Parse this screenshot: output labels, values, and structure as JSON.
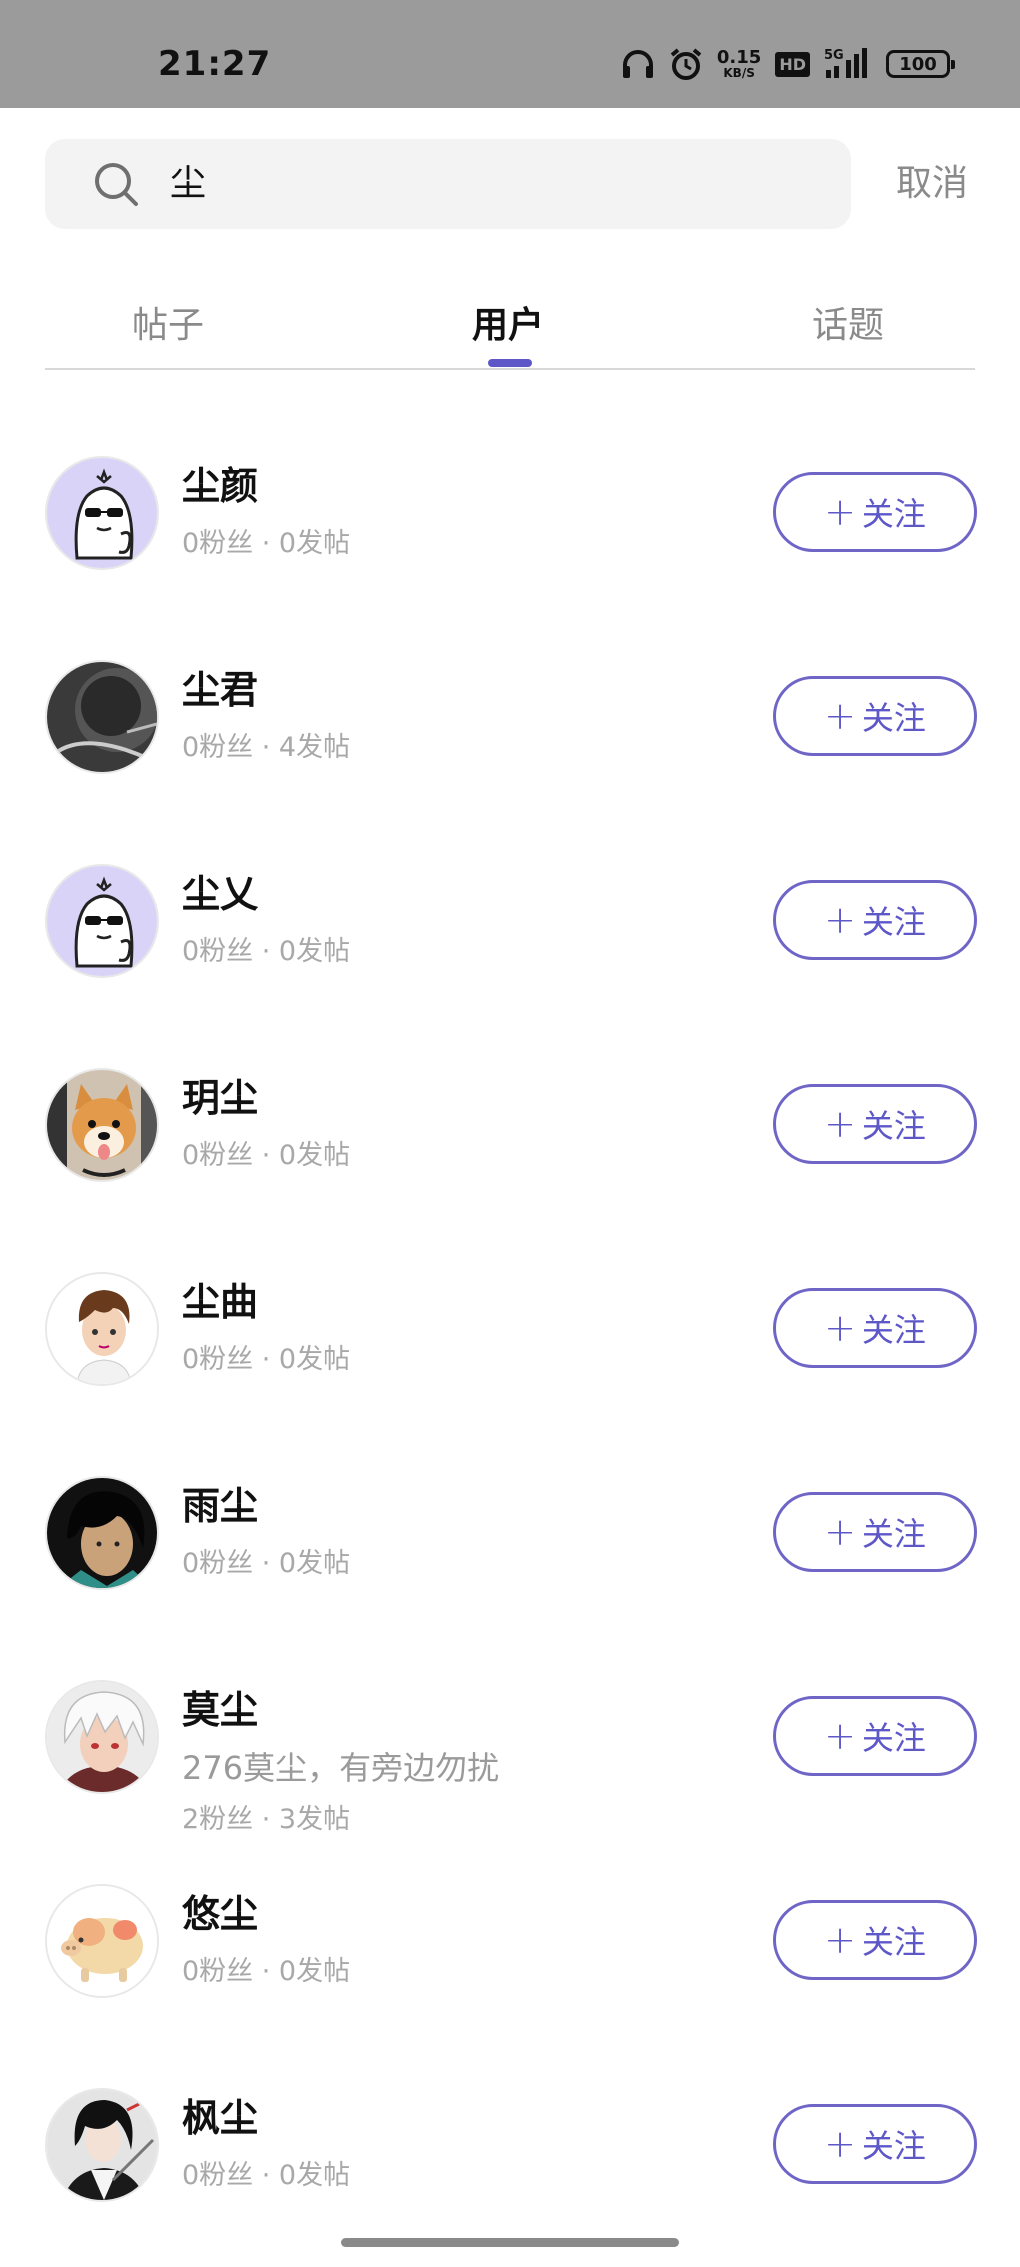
{
  "status_bar": {
    "time": "21:27",
    "net_speed_value": "0.15",
    "net_speed_unit": "KB/S",
    "hd": "HD",
    "network": "5G",
    "battery": "100",
    "icons": [
      "headphones-icon",
      "alarm-icon",
      "signal-icon"
    ]
  },
  "search": {
    "query": "尘",
    "cancel_label": "取消",
    "icon": "search-icon"
  },
  "tabs": [
    {
      "label": "帖子",
      "active": false
    },
    {
      "label": "用户",
      "active": true
    },
    {
      "label": "话题",
      "active": false
    }
  ],
  "accent_color": "#5d57c8",
  "users": [
    {
      "name": "尘颜",
      "bio": "",
      "stats": "0粉丝 · 0发帖",
      "follow_label": "关注",
      "avatar": "ghost-sunglasses"
    },
    {
      "name": "尘君",
      "bio": "",
      "stats": "0粉丝 · 4发帖",
      "follow_label": "关注",
      "avatar": "dark-photo"
    },
    {
      "name": "尘乂",
      "bio": "",
      "stats": "0粉丝 · 0发帖",
      "follow_label": "关注",
      "avatar": "ghost-sunglasses"
    },
    {
      "name": "玥尘",
      "bio": "",
      "stats": "0粉丝 · 0发帖",
      "follow_label": "关注",
      "avatar": "shiba-dog"
    },
    {
      "name": "尘曲",
      "bio": "",
      "stats": "0粉丝 · 0发帖",
      "follow_label": "关注",
      "avatar": "cartoon-boy"
    },
    {
      "name": "雨尘",
      "bio": "",
      "stats": "0粉丝 · 0发帖",
      "follow_label": "关注",
      "avatar": "dark-hair-man"
    },
    {
      "name": "莫尘",
      "bio": "276莫尘，有旁边勿扰",
      "stats": "2粉丝 · 3发帖",
      "follow_label": "关注",
      "avatar": "anime-white-hair"
    },
    {
      "name": "悠尘",
      "bio": "",
      "stats": "0粉丝 · 0发帖",
      "follow_label": "关注",
      "avatar": "pig"
    },
    {
      "name": "枫尘",
      "bio": "",
      "stats": "0粉丝 · 0发帖",
      "follow_label": "关注",
      "avatar": "anime-swordsman"
    }
  ]
}
